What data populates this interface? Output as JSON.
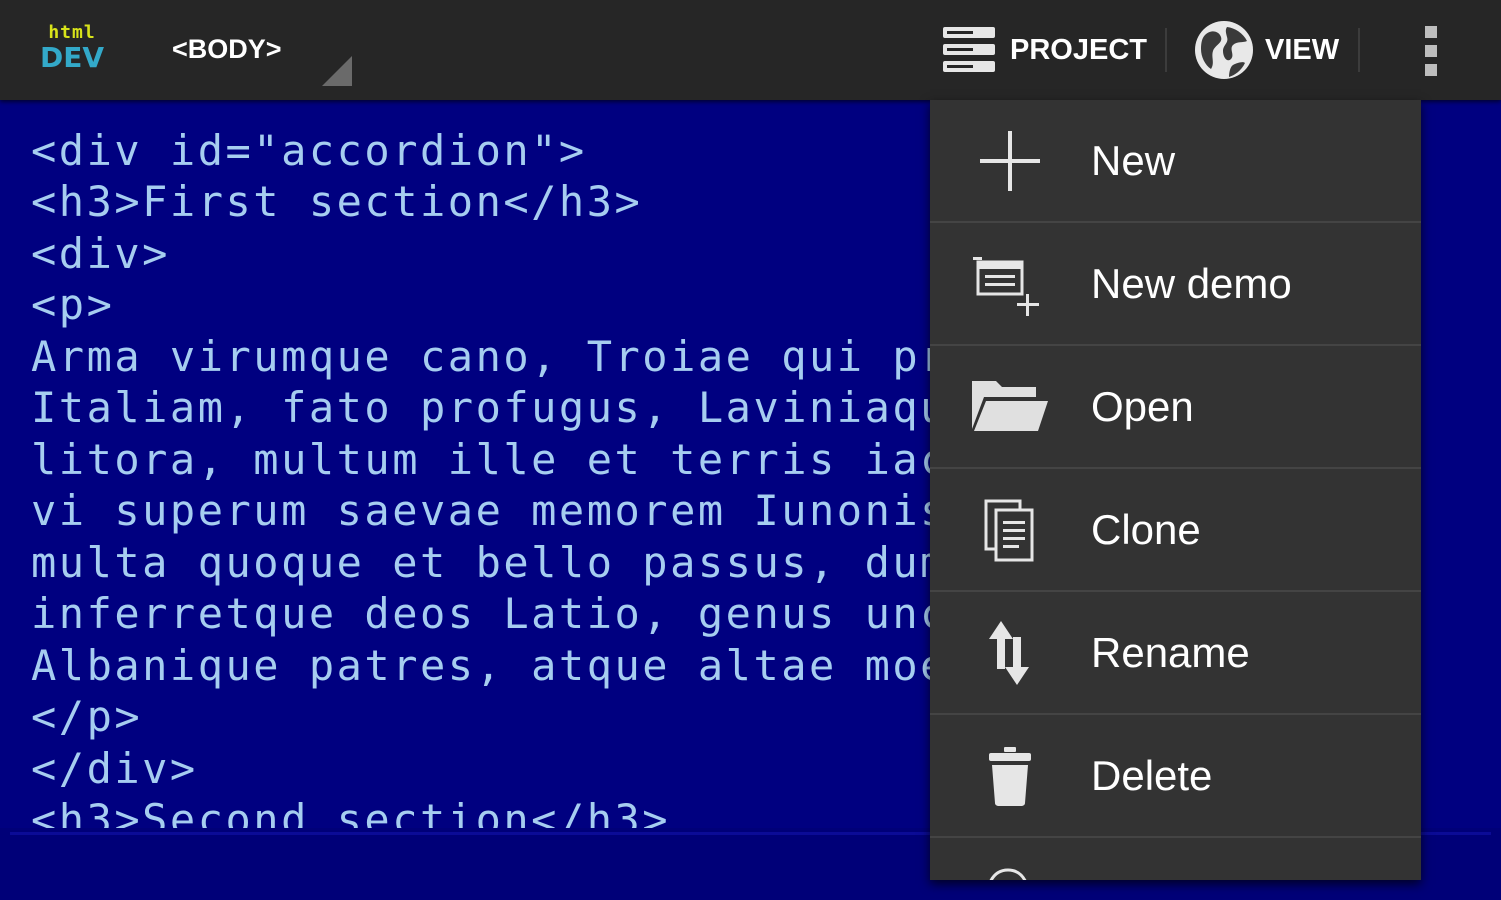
{
  "colors": {
    "editor_background": "#000080",
    "editor_text": "#a6cdf0",
    "actionbar_background": "#262626",
    "menu_background": "#333333",
    "logo_top": "#d8e31a",
    "logo_bottom": "#33a9c9"
  },
  "actionbar": {
    "logo": {
      "line1": "html",
      "line2": "DEV"
    },
    "breadcrumb": "<BODY>",
    "project_label": "PROJECT",
    "project_icon": "server-stack-icon",
    "view_label": "VIEW",
    "view_icon": "globe-icon",
    "overflow_icon": "overflow-menu-icon"
  },
  "editor": {
    "lines": [
      "<div id=\"accordion\">",
      "<h3>First section</h3>",
      "<div>",
      "<p>",
      "Arma virumque cano, Troiae qui pr",
      "Italiam, fato profugus, Laviniaqu",
      "litora, multum ille et terris iac",
      "vi superum saevae memorem Iunonis",
      "multa quoque et bello passus, dum",
      "inferretque deos Latio, genus unc",
      "Albanique patres, atque altae moe",
      "</p>",
      "</div>",
      "<h3>Second section</h3>"
    ]
  },
  "menu": {
    "items": [
      {
        "label": "New",
        "icon": "plus-icon"
      },
      {
        "label": "New demo",
        "icon": "new-demo-icon"
      },
      {
        "label": "Open",
        "icon": "folder-open-icon"
      },
      {
        "label": "Clone",
        "icon": "copy-icon"
      },
      {
        "label": "Rename",
        "icon": "rename-arrows-icon"
      },
      {
        "label": "Delete",
        "icon": "trash-icon"
      }
    ]
  }
}
